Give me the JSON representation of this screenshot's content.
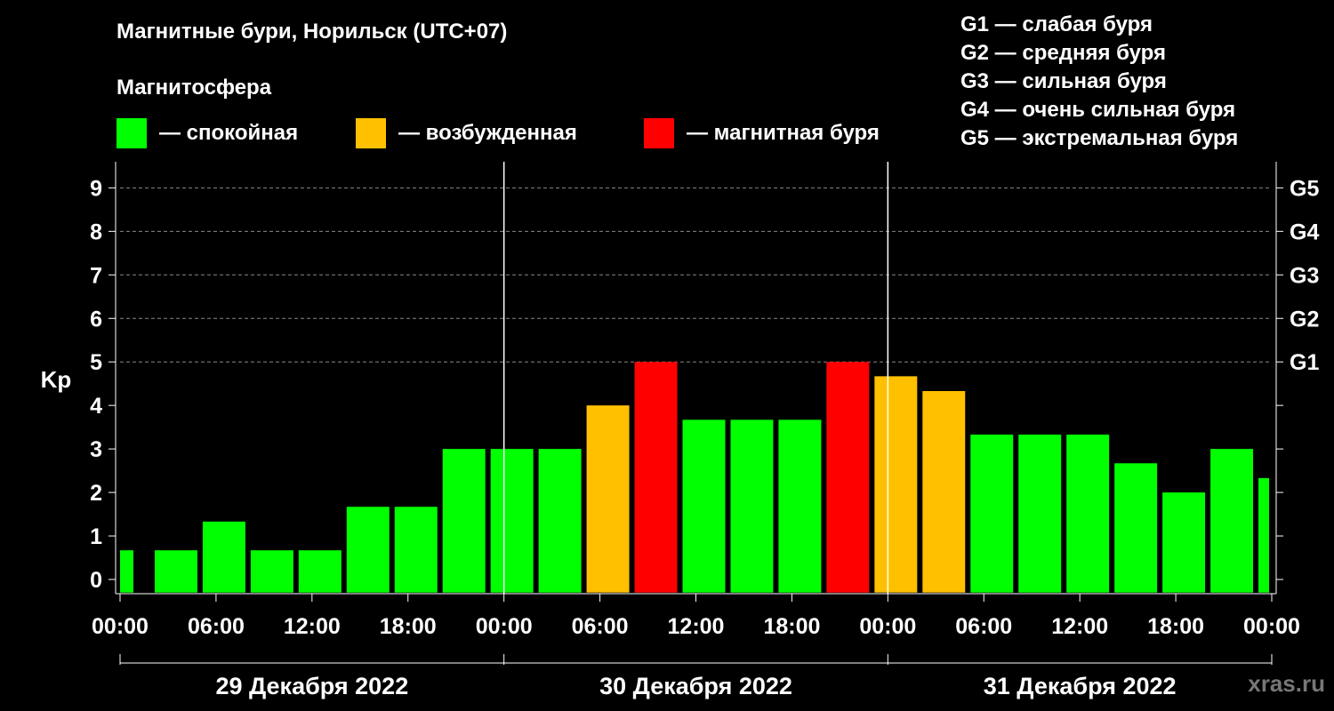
{
  "header": {
    "title": "Магнитные бури, Норильск (UTC+07)",
    "subtitle": "Магнитосфера"
  },
  "legend": {
    "items": [
      {
        "label": "— спокойная",
        "color": "#00ff00"
      },
      {
        "label": "— возбужденная",
        "color": "#ffc000"
      },
      {
        "label": "— магнитная буря",
        "color": "#ff0000"
      }
    ],
    "g_scale": [
      "G1 — слабая буря",
      "G2 — средняя буря",
      "G3 — сильная буря",
      "G4 — очень сильная буря",
      "G5 — экстремальная буря"
    ]
  },
  "watermark": "xras.ru",
  "chart_data": {
    "type": "bar",
    "ylabel": "Kp",
    "ylim": [
      0,
      9
    ],
    "y_ticks": [
      "0",
      "1",
      "2",
      "3",
      "4",
      "5",
      "6",
      "7",
      "8",
      "9"
    ],
    "right_ticks": [
      {
        "kp": 5,
        "label": "G1"
      },
      {
        "kp": 6,
        "label": "G2"
      },
      {
        "kp": 7,
        "label": "G3"
      },
      {
        "kp": 8,
        "label": "G4"
      },
      {
        "kp": 9,
        "label": "G5"
      }
    ],
    "x_tick_labels": [
      "00:00",
      "06:00",
      "12:00",
      "18:00",
      "00:00",
      "06:00",
      "12:00",
      "18:00",
      "00:00",
      "06:00",
      "12:00",
      "18:00",
      "00:00"
    ],
    "day_labels": [
      "29 Декабря 2022",
      "30 Декабря 2022",
      "31 Декабря 2022"
    ],
    "series": [
      {
        "start_hours": [
          0,
          2,
          5,
          8,
          11,
          14,
          17,
          20,
          23,
          26,
          29,
          32,
          35,
          38,
          41,
          44,
          47,
          50,
          53,
          56,
          59,
          62,
          65,
          68,
          71
        ],
        "duration_hours": [
          1,
          3,
          3,
          3,
          3,
          3,
          3,
          3,
          3,
          3,
          3,
          3,
          3,
          3,
          3,
          3,
          3,
          3,
          3,
          3,
          3,
          3,
          3,
          3,
          1
        ],
        "values": [
          0.67,
          0.67,
          1.33,
          0.67,
          0.67,
          1.67,
          1.67,
          3,
          3,
          3,
          4,
          5,
          3.67,
          3.67,
          3.67,
          5,
          4.67,
          4.33,
          3.33,
          3.33,
          3.33,
          2.67,
          2,
          3,
          2.33
        ],
        "colors": [
          "#00ff00",
          "#00ff00",
          "#00ff00",
          "#00ff00",
          "#00ff00",
          "#00ff00",
          "#00ff00",
          "#00ff00",
          "#00ff00",
          "#00ff00",
          "#ffc000",
          "#ff0000",
          "#00ff00",
          "#00ff00",
          "#00ff00",
          "#ff0000",
          "#ffc000",
          "#ffc000",
          "#00ff00",
          "#00ff00",
          "#00ff00",
          "#00ff00",
          "#00ff00",
          "#00ff00",
          "#00ff00"
        ]
      }
    ],
    "grid": true,
    "total_hours": 72
  }
}
